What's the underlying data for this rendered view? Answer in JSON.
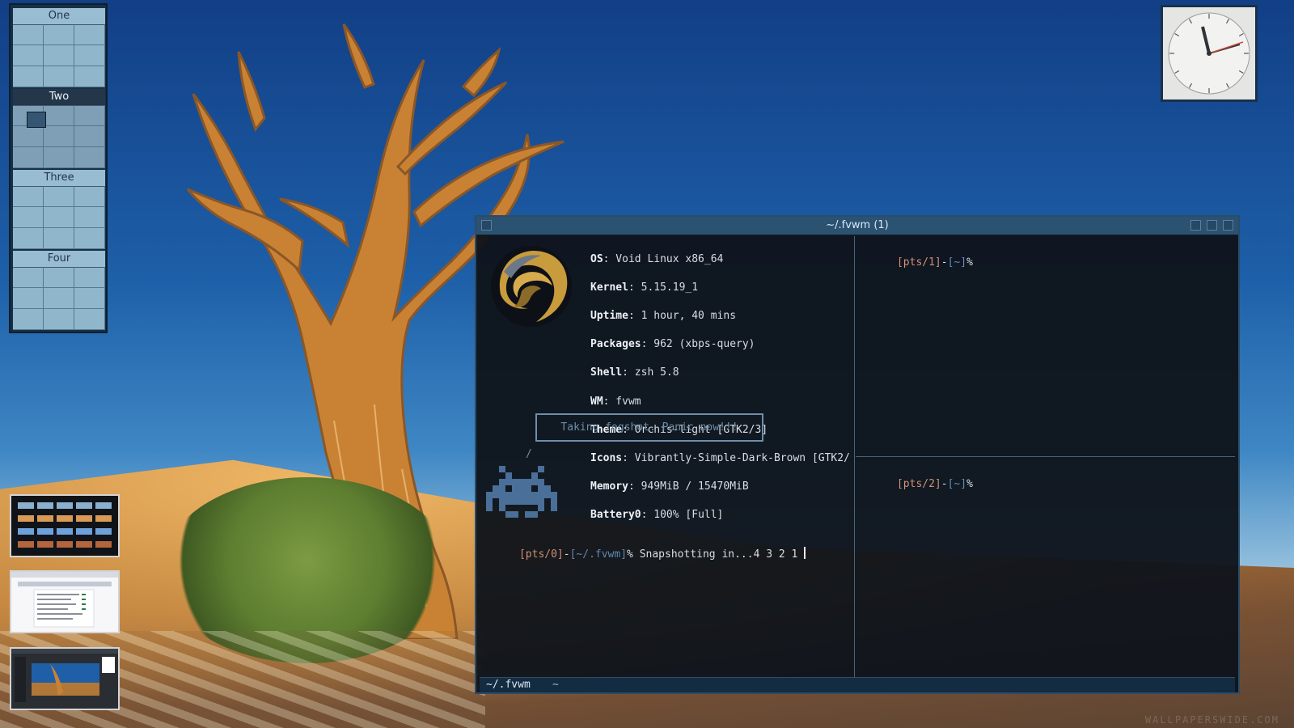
{
  "desktop": {
    "pager": {
      "desks": [
        {
          "label": "One",
          "active": false
        },
        {
          "label": "Two",
          "active": true
        },
        {
          "label": "Three",
          "active": false
        },
        {
          "label": "Four",
          "active": false
        }
      ]
    },
    "terminal": {
      "title": "~/.fvwm (1)",
      "left_pane": {
        "info_lines": [
          {
            "key": "OS",
            "value": ": Void Linux x86_64"
          },
          {
            "key": "Kernel",
            "value": ": 5.15.19_1"
          },
          {
            "key": "Uptime",
            "value": ": 1 hour, 40 mins"
          },
          {
            "key": "Packages",
            "value": ": 962 (xbps-query)"
          },
          {
            "key": "Shell",
            "value": ": zsh 5.8"
          },
          {
            "key": "WM",
            "value": ": fvwm"
          },
          {
            "key": "Theme",
            "value": ": Orchis-light [GTK2/3]"
          },
          {
            "key": "Icons",
            "value": ": Vibrantly-Simple-Dark-Brown [GTK2/"
          },
          {
            "key": "Memory",
            "value": ": 949MiB / 15470MiB"
          },
          {
            "key": "Battery0",
            "value": ": 100% [Full]"
          }
        ],
        "notice": "Taking fogshot. Panic now!!!",
        "slash": "/",
        "prompt_tag": "[pts/0]",
        "prompt_sep": "-",
        "prompt_path": "[~/.fvwm]",
        "prompt_suffix": "% Snapshotting in...4 3 2 1 "
      },
      "right_top": {
        "tag": "[pts/1]",
        "sep": "-",
        "path": "[~]",
        "suffix": "%"
      },
      "right_bottom": {
        "tag": "[pts/2]",
        "sep": "-",
        "path": "[~]",
        "suffix": "%"
      },
      "status_bar": {
        "left": "~/.fvwm",
        "right": "~"
      }
    },
    "watermark": "WALLPAPERSWIDE.COM"
  }
}
